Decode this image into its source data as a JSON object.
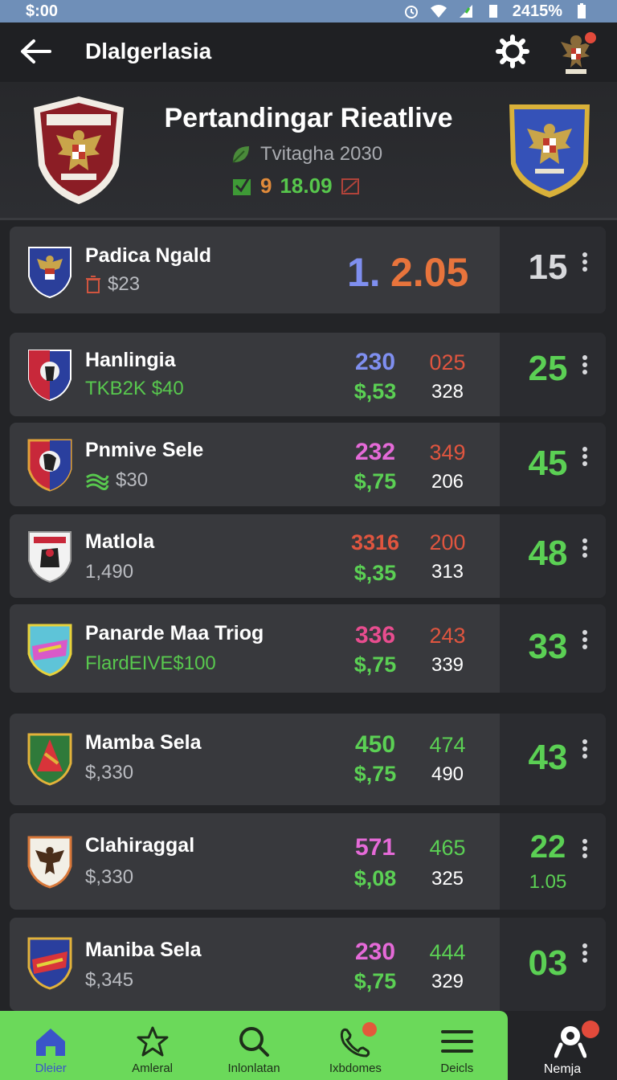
{
  "status_bar": {
    "time": "$:00",
    "battery": "2415%"
  },
  "app_bar": {
    "title": "Dlalgerlasia"
  },
  "header": {
    "title": "Pertandingar Rieatlive",
    "subtitle": "Tvitagha 2030",
    "score_left": "9",
    "score_right": "18.09"
  },
  "rows": [
    {
      "name": "Padica Ngald",
      "sub": "$23",
      "val_a": "1.",
      "val_c": "2.05",
      "score": "15"
    },
    {
      "name": "Hanlingia",
      "sub": "TKB2K $40",
      "val_a": "230",
      "val_b": "$,53",
      "val_c": "025",
      "val_d": "328",
      "score": "25"
    },
    {
      "name": "Pnmive Sele",
      "sub": "$30",
      "val_a": "232",
      "val_b": "$,75",
      "val_c": "349",
      "val_d": "206",
      "score": "45"
    },
    {
      "name": "Matlola",
      "sub": "1,490",
      "val_a": "3316",
      "val_b": "$,35",
      "val_c": "200",
      "val_d": "313",
      "score": "48"
    },
    {
      "name": "Panarde Maa Triog",
      "sub": "FlardEIVE$100",
      "val_a": "336",
      "val_b": "$,75",
      "val_c": "243",
      "val_d": "339",
      "score": "33"
    },
    {
      "name": "Mamba Sela",
      "sub": "$,330",
      "val_a": "450",
      "val_b": "$,75",
      "val_c": "474",
      "val_d": "490",
      "score": "43"
    },
    {
      "name": "Clahiraggal",
      "sub": "$,330",
      "val_a": "571",
      "val_b": "$,08",
      "val_c": "465",
      "val_d": "325",
      "score": "22",
      "sub_score": "1.05"
    },
    {
      "name": "Maniba Sela",
      "sub": "$,345",
      "val_a": "230",
      "val_b": "$,75",
      "val_c": "444",
      "val_d": "329",
      "score": "03"
    }
  ],
  "colors": {
    "accent_green": "#5bd054",
    "blue": "#7f8ff0",
    "orange": "#e8743c",
    "red": "#e0553f",
    "magenta": "#e56ad8",
    "pink": "#e84d8f",
    "nav_bg": "#6bd95a"
  },
  "bottom_nav": {
    "items": [
      {
        "label": "Dleier",
        "icon": "home-icon"
      },
      {
        "label": "Amleral",
        "icon": "star-icon"
      },
      {
        "label": "Inlonlatan",
        "icon": "search-icon"
      },
      {
        "label": "Ixbdomes",
        "icon": "phone-icon"
      },
      {
        "label": "Deicls",
        "icon": "menu-icon"
      }
    ],
    "extra": {
      "label": "Nemja",
      "icon": "person-icon"
    }
  }
}
